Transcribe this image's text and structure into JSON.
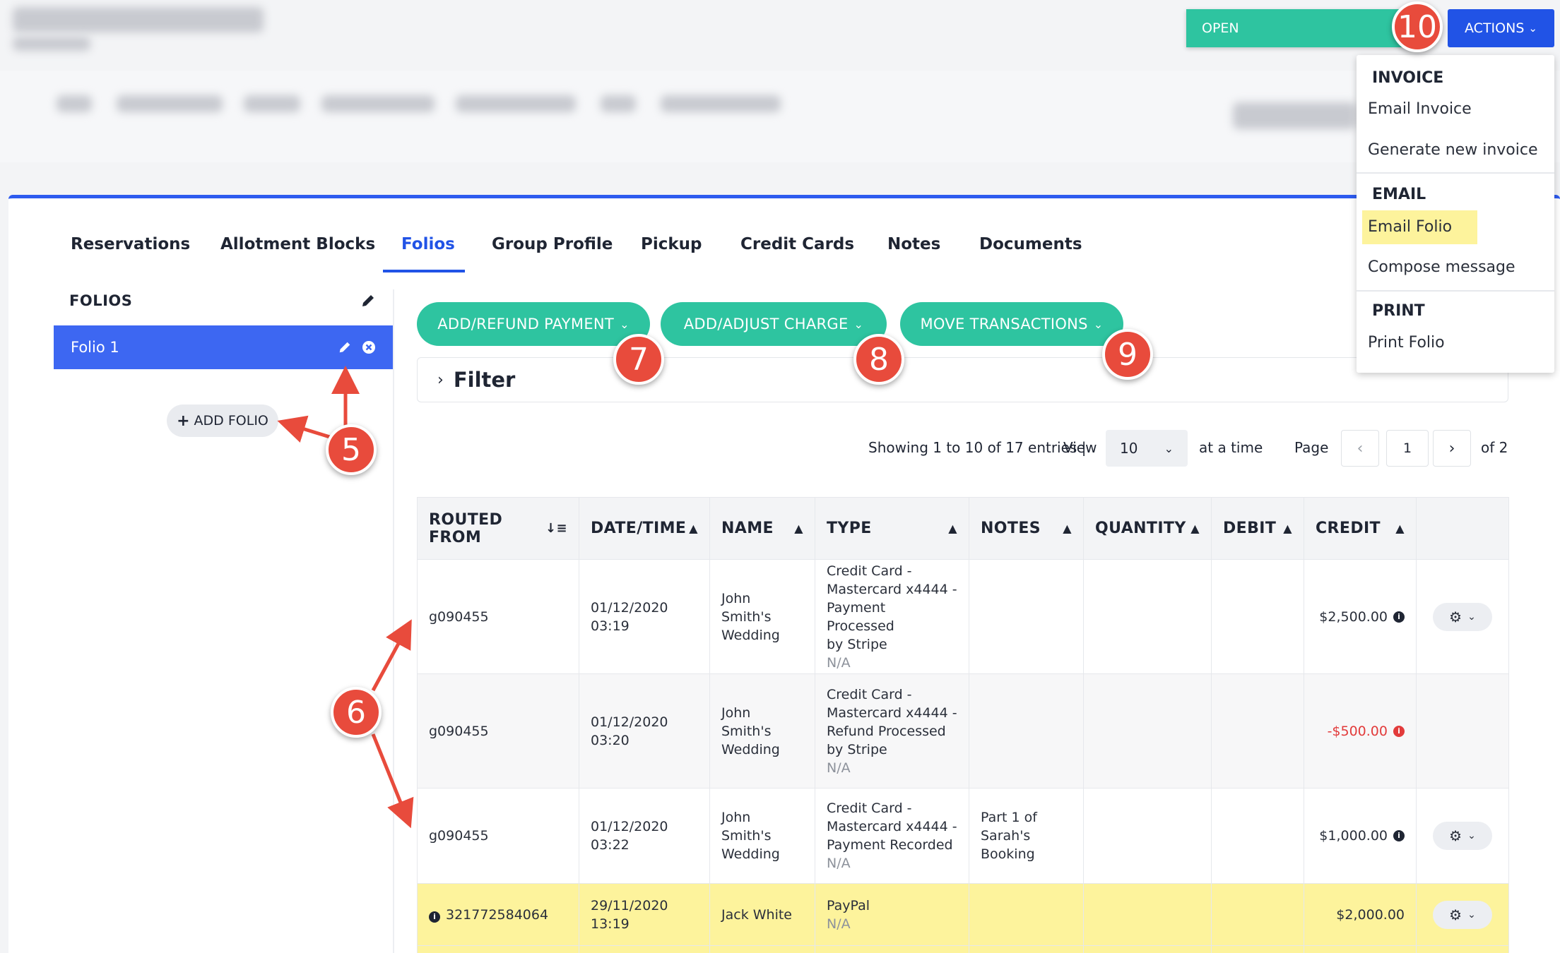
{
  "colors": {
    "primary": "#2153e6",
    "green": "#2ec4a0",
    "highlight": "#fdf39c",
    "annotation": "#e84b3c",
    "negative": "#e23b3b"
  },
  "header": {
    "status": "OPEN",
    "actions_label": "ACTIONS"
  },
  "actions_menu": {
    "invoice_heading": "INVOICE",
    "email_invoice": "Email Invoice",
    "generate_invoice": "Generate new invoice",
    "email_heading": "EMAIL",
    "email_folio": "Email Folio",
    "compose_message": "Compose message",
    "print_heading": "PRINT",
    "print_folio": "Print Folio"
  },
  "tabs": [
    "Reservations",
    "Allotment Blocks",
    "Folios",
    "Group Profile",
    "Pickup",
    "Credit Cards",
    "Notes",
    "Documents"
  ],
  "sidebar": {
    "title": "FOLIOS",
    "folio_name": "Folio 1",
    "add_folio": "ADD FOLIO"
  },
  "toolbar": {
    "add_refund": "ADD/REFUND PAYMENT",
    "add_adjust": "ADD/ADJUST CHARGE",
    "move": "MOVE TRANSACTIONS"
  },
  "filter": {
    "label": "Filter"
  },
  "pagination": {
    "showing": "Showing 1 to 10 of 17 entries |",
    "view": "View",
    "per_page": "10",
    "at_a_time": "at a time",
    "page_label": "Page",
    "page": "1",
    "of": "of 2"
  },
  "table": {
    "headers": [
      "ROUTED FROM",
      "DATE/TIME",
      "NAME",
      "TYPE",
      "NOTES",
      "QUANTITY",
      "DEBIT",
      "CREDIT"
    ],
    "rows": [
      {
        "routed": "g090455",
        "date": "01/12/2020",
        "time": "03:19",
        "name1": "John",
        "name2": "Smith's",
        "name3": "Wedding",
        "type1": "Credit Card -",
        "type2": "Mastercard x4444 -",
        "type3": "Payment Processed",
        "type4": "by Stripe",
        "type_sub": "N/A",
        "notes1": "",
        "notes2": "",
        "notes3": "",
        "credit": "$2,500.00"
      },
      {
        "routed": "g090455",
        "date": "01/12/2020",
        "time": "03:20",
        "name1": "John",
        "name2": "Smith's",
        "name3": "Wedding",
        "type1": "Credit Card -",
        "type2": "Mastercard x4444 -",
        "type3": "Refund Processed",
        "type4": "by Stripe",
        "type_sub": "N/A",
        "notes1": "",
        "notes2": "",
        "notes3": "",
        "credit": "-$500.00"
      },
      {
        "routed": "g090455",
        "date": "01/12/2020",
        "time": "03:22",
        "name1": "John",
        "name2": "Smith's",
        "name3": "Wedding",
        "type1": "Credit Card -",
        "type2": "Mastercard x4444 -",
        "type3": "Payment Recorded",
        "type4": "",
        "type_sub": "N/A",
        "notes1": "Part 1 of",
        "notes2": "Sarah's",
        "notes3": "Booking",
        "credit": "$1,000.00"
      },
      {
        "routed": "321772584064",
        "date": "29/11/2020",
        "time": "13:19",
        "name1": "Jack White",
        "name2": "",
        "name3": "",
        "type1": "PayPal",
        "type2": "",
        "type3": "",
        "type4": "",
        "type_sub": "N/A",
        "notes1": "",
        "notes2": "",
        "notes3": "",
        "credit": "$2,000.00"
      }
    ]
  },
  "annotations": [
    "5",
    "6",
    "7",
    "8",
    "9",
    "10"
  ]
}
